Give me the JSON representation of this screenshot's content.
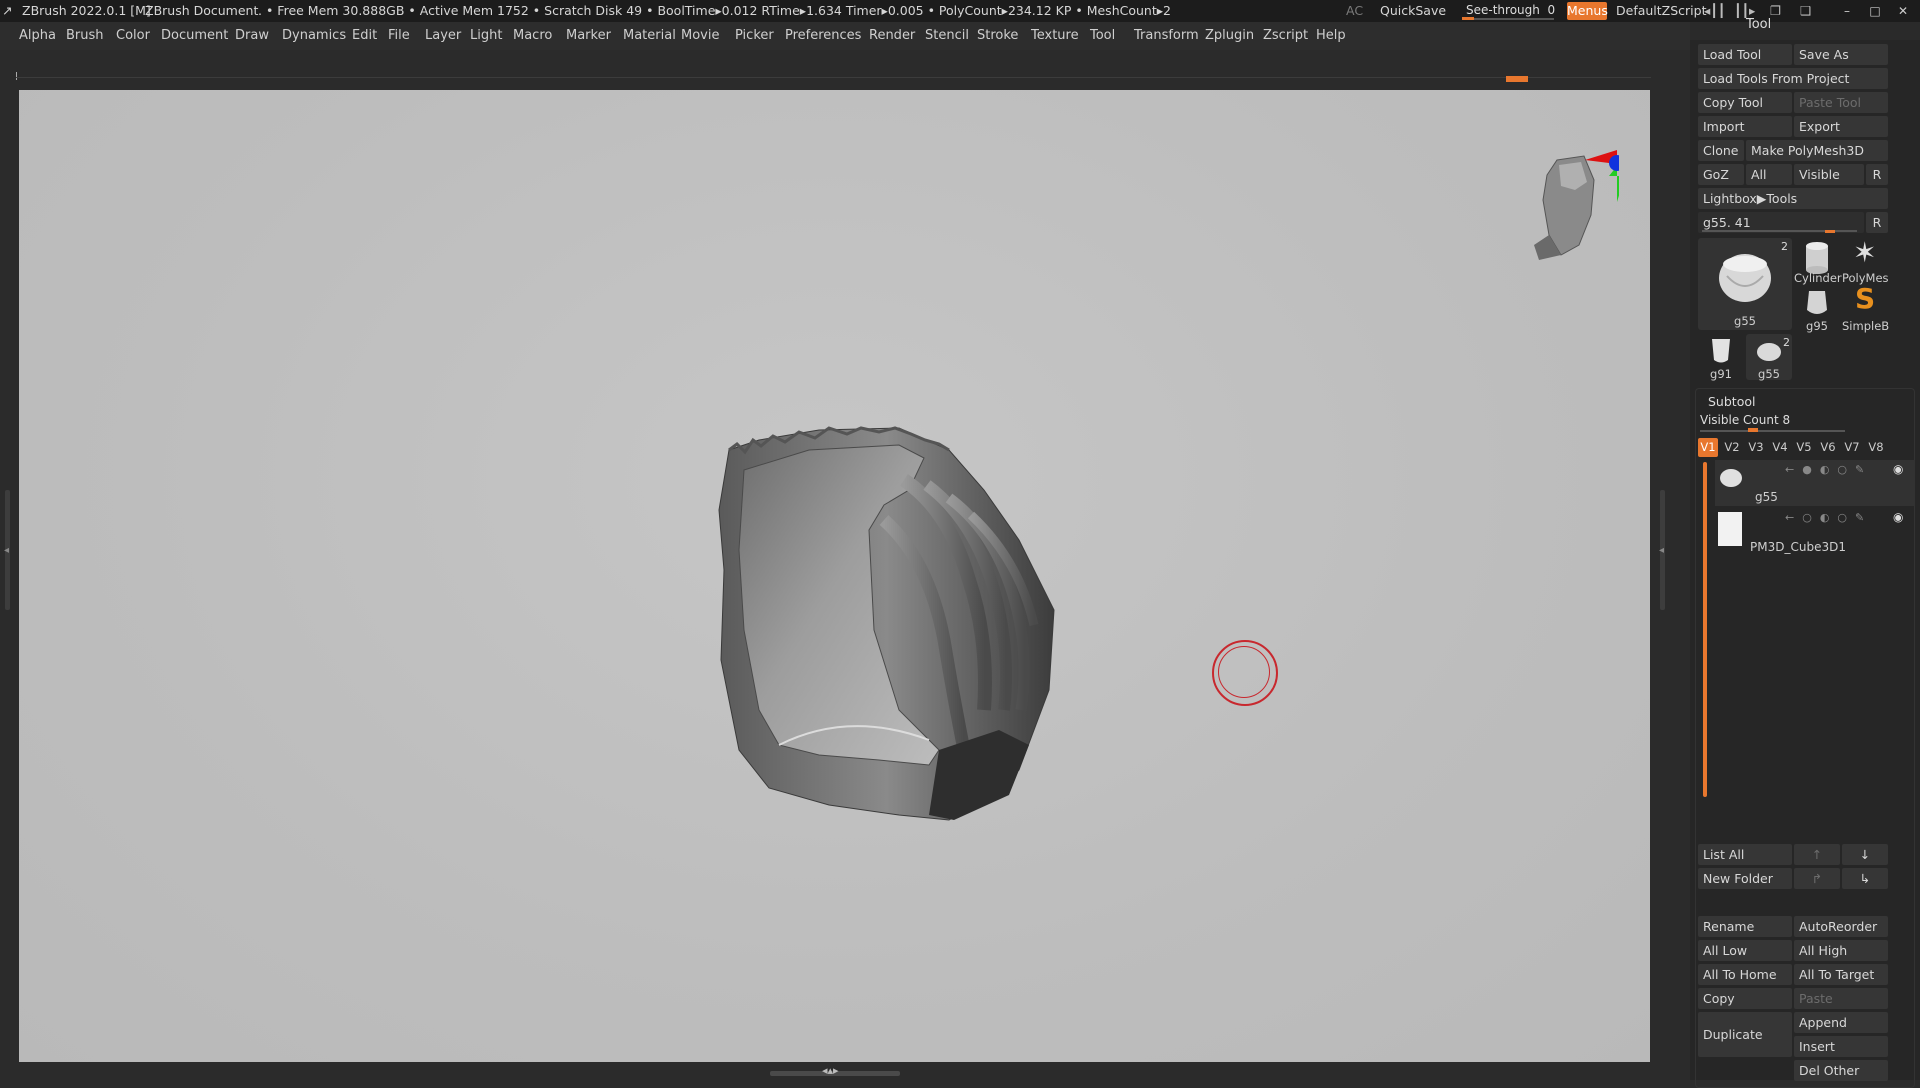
{
  "titlebar": {
    "app": "ZBrush 2022.0.1 [M]",
    "document": "ZBrush Document",
    "stats": ". • Free Mem 30.888GB • Active Mem 1752 • Scratch Disk 49 •  BoolTime▸0.012 RTime▸1.634 Timer▸0.005 • PolyCount▸234.12 KP  • MeshCount▸2",
    "ac": "AC",
    "quicksave": "QuickSave",
    "see_through_label": "See-through",
    "see_through_value": "0",
    "see_through_level": 0,
    "menus": "Menus",
    "default_zscript": "DefaultZScript"
  },
  "menubar": {
    "items": [
      "Alpha",
      "Brush",
      "Color",
      "Document",
      "Draw",
      "Dynamics",
      "Edit",
      "File",
      "Layer",
      "Light",
      "Macro",
      "Marker",
      "Material",
      "Movie",
      "Picker",
      "Preferences",
      "Render",
      "Stencil",
      "Stroke",
      "Texture",
      "Tool",
      "Transform",
      "Zplugin",
      "Zscript",
      "Help"
    ]
  },
  "palette": {
    "title": "Tool",
    "buttons": {
      "load_tool": "Load Tool",
      "save_as": "Save As",
      "load_tools_from_project": "Load Tools From Project",
      "copy_tool": "Copy Tool",
      "paste_tool": "Paste Tool",
      "import": "Import",
      "export": "Export",
      "clone": "Clone",
      "make_polymesh": "Make PolyMesh3D",
      "goz": "GoZ",
      "all": "All",
      "visible": "Visible",
      "r": "R",
      "lightbox_tools": "Lightbox▶Tools"
    },
    "current_tool": "g55. 41",
    "current_tool_slider": 0.8,
    "thumbs": {
      "main": {
        "label": "g55",
        "count": "2"
      },
      "cylinder": "Cylinder",
      "polymesh": "PolyMes",
      "g95": "g95",
      "simpleb": "SimpleB",
      "g91": "g91",
      "g55_small": {
        "label": "g55",
        "count": "2"
      }
    },
    "subtool": {
      "title": "Subtool",
      "visible_count_label": "Visible Count",
      "visible_count": "8",
      "visible_count_level": 0.3,
      "tabs": [
        "V1",
        "V2",
        "V3",
        "V4",
        "V5",
        "V6",
        "V7",
        "V8"
      ],
      "active_tab": "V1",
      "items": [
        {
          "name": "g55"
        },
        {
          "name": "PM3D_Cube3D1"
        }
      ]
    },
    "bottom_buttons": {
      "list_all": "List All",
      "new_folder": "New Folder",
      "rename": "Rename",
      "autoreorder": "AutoReorder",
      "all_low": "All Low",
      "all_high": "All High",
      "all_to_home": "All To Home",
      "all_to_target": "All To Target",
      "copy": "Copy",
      "paste": "Paste",
      "duplicate": "Duplicate",
      "append": "Append",
      "insert": "Insert",
      "del_other": "Del Other"
    }
  },
  "colors": {
    "accent": "#e8772e",
    "canvas": "#bdbdbd",
    "brush_cursor": "#c8282e"
  }
}
